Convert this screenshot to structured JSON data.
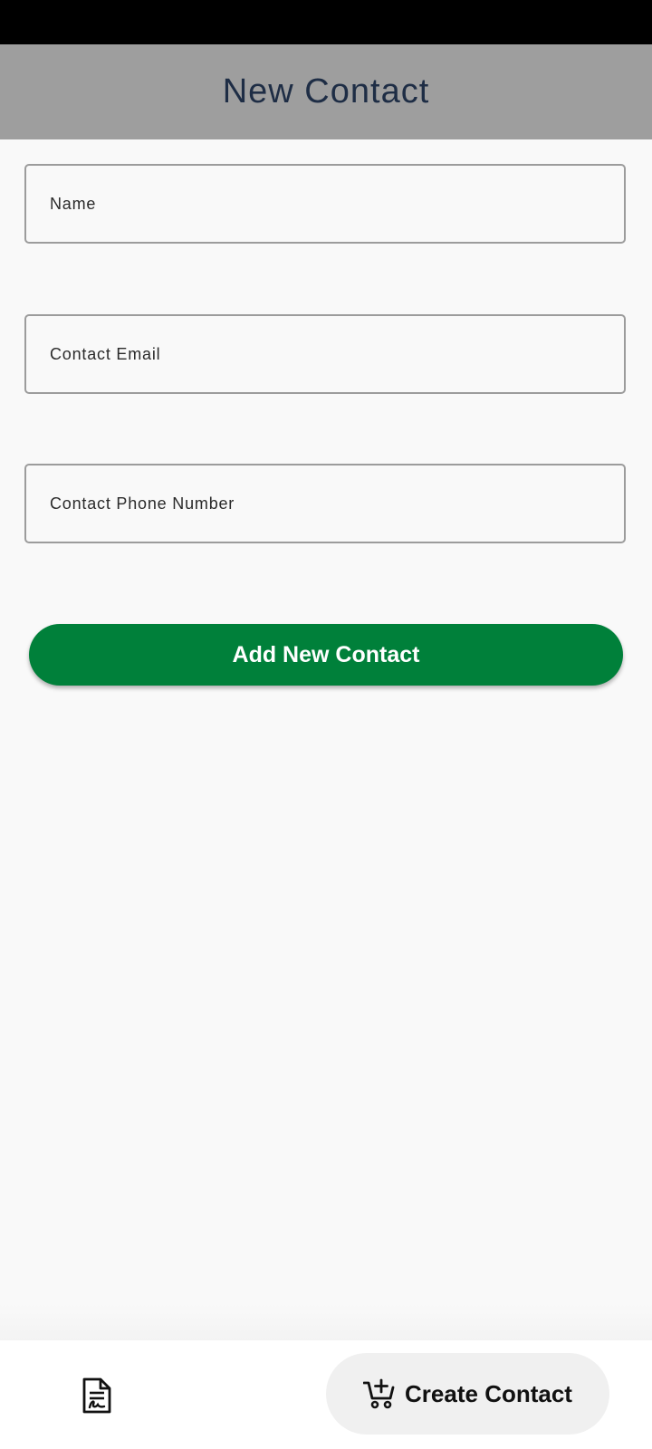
{
  "app_bar": {
    "title": "New Contact"
  },
  "form": {
    "name_placeholder": "Name",
    "email_placeholder": "Contact Email",
    "phone_placeholder": "Contact Phone Number",
    "submit_label": "Add New Contact"
  },
  "bottom_nav": {
    "items": [
      {
        "icon": "document-signature-icon"
      },
      {
        "icon": "cart-plus-icon",
        "label": "Create Contact"
      }
    ]
  },
  "colors": {
    "app_bar_background": "#9e9e9e",
    "title_text": "#1e2d45",
    "primary_button": "#00803a"
  }
}
